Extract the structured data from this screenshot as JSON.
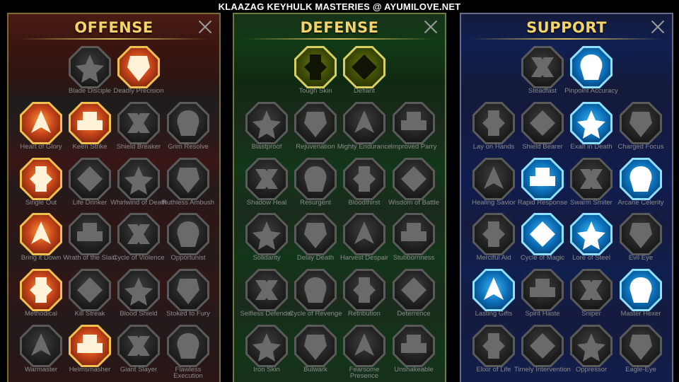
{
  "banner": "KLAAZAG KEYHULK MASTERIES @ AYUMILOVE.NET",
  "panels": [
    {
      "key": "offense",
      "title": "OFFENSE",
      "accent": "#f3d36a",
      "rows": [
        [
          {
            "name": "Blade Disciple",
            "icon": "crossed-swords-icon",
            "active": false
          },
          {
            "name": "Deadly Precision",
            "icon": "dagger-icon",
            "active": true
          }
        ],
        [
          {
            "name": "Heart of Glory",
            "icon": "horned-figure-icon",
            "active": true
          },
          {
            "name": "Keen Strike",
            "icon": "slash-icon",
            "active": true
          },
          {
            "name": "Shield Breaker",
            "icon": "shield-break-icon",
            "active": false
          },
          {
            "name": "Grim Resolve",
            "icon": "grim-heart-icon",
            "active": false
          }
        ],
        [
          {
            "name": "Single Out",
            "icon": "target-arrows-icon",
            "active": true
          },
          {
            "name": "Life Drinker",
            "icon": "fangs-icon",
            "active": false
          },
          {
            "name": "Whirlwind of Death",
            "icon": "whirlwind-icon",
            "active": false
          },
          {
            "name": "Ruthless Ambush",
            "icon": "ambush-dagger-icon",
            "active": false
          }
        ],
        [
          {
            "name": "Bring it Down",
            "icon": "falling-sword-icon",
            "active": true
          },
          {
            "name": "Wrath of the Slain",
            "icon": "fist-hammer-icon",
            "active": false
          },
          {
            "name": "Cycle of Violence",
            "icon": "axe-cycle-icon",
            "active": false
          },
          {
            "name": "Opportunist",
            "icon": "chain-lightning-icon",
            "active": false
          }
        ],
        [
          {
            "name": "Methodical",
            "icon": "burst-icon",
            "active": true
          },
          {
            "name": "Kill Streak",
            "icon": "skull-icon",
            "active": false
          },
          {
            "name": "Blood Shield",
            "icon": "sword-shield-icon",
            "active": false
          },
          {
            "name": "Stoked to Fury",
            "icon": "fury-figure-icon",
            "active": false
          }
        ],
        [
          {
            "name": "Warmaster",
            "icon": "sword-stars-icon",
            "active": false
          },
          {
            "name": "Helmsmasher",
            "icon": "helmet-icon",
            "active": true
          },
          {
            "name": "Giant Slayer",
            "icon": "giant-icon",
            "active": false
          },
          {
            "name": "Flawless Execution",
            "icon": "skull-blade-icon",
            "active": false
          }
        ]
      ]
    },
    {
      "key": "defense",
      "title": "DEFENSE",
      "accent": "#f3d36a",
      "rows": [
        [
          {
            "name": "Tough Skin",
            "icon": "armor-plates-icon",
            "active": true
          },
          {
            "name": "Defiant",
            "icon": "raised-fist-icon",
            "active": true
          }
        ],
        [
          {
            "name": "Blastproof",
            "icon": "blast-shield-icon",
            "active": false
          },
          {
            "name": "Rejuvenation",
            "icon": "leaf-hand-icon",
            "active": false
          },
          {
            "name": "Mighty Endurance",
            "icon": "strongman-icon",
            "active": false
          },
          {
            "name": "Improved Parry",
            "icon": "parry-blades-icon",
            "active": false
          }
        ],
        [
          {
            "name": "Shadow Heal",
            "icon": "shadow-figure-icon",
            "active": false
          },
          {
            "name": "Resurgent",
            "icon": "knight-shield-icon",
            "active": false
          },
          {
            "name": "Bloodthirst",
            "icon": "heart-skull-icon",
            "active": false
          },
          {
            "name": "Wisdom of Battle",
            "icon": "spiral-icon",
            "active": false
          }
        ],
        [
          {
            "name": "Solidarity",
            "icon": "group-fist-icon",
            "active": false
          },
          {
            "name": "Delay Death",
            "icon": "hourglass-icon",
            "active": false
          },
          {
            "name": "Harvest Despair",
            "icon": "open-hand-icon",
            "active": false
          },
          {
            "name": "Stubbornness",
            "icon": "bull-icon",
            "active": false
          }
        ],
        [
          {
            "name": "Selfless Defender",
            "icon": "runner-icon",
            "active": false
          },
          {
            "name": "Cycle of Revenge",
            "icon": "flames-icon",
            "active": false
          },
          {
            "name": "Retribution",
            "icon": "gear-skull-icon",
            "active": false
          },
          {
            "name": "Deterrence",
            "icon": "deflect-icon",
            "active": false
          }
        ],
        [
          {
            "name": "Iron Skin",
            "icon": "iron-figure-icon",
            "active": false
          },
          {
            "name": "Bulwark",
            "icon": "shield-icon",
            "active": false
          },
          {
            "name": "Fearsome Presence",
            "icon": "demon-face-icon",
            "active": false
          },
          {
            "name": "Unshakeable",
            "icon": "flex-figure-icon",
            "active": false
          }
        ]
      ]
    },
    {
      "key": "support",
      "title": "SUPPORT",
      "accent": "#f3d36a",
      "rows": [
        [
          {
            "name": "Steadfast",
            "icon": "sparkle-heart-icon",
            "active": false
          },
          {
            "name": "Pinpoint Accuracy",
            "icon": "bullseye-icon",
            "active": true
          }
        ],
        [
          {
            "name": "Lay on Hands",
            "icon": "praying-hands-icon",
            "active": false
          },
          {
            "name": "Shield Bearer",
            "icon": "arc-shield-icon",
            "active": false
          },
          {
            "name": "Exalt in Death",
            "icon": "blue-skull-icon",
            "active": true
          },
          {
            "name": "Charged Focus",
            "icon": "charged-arrow-icon",
            "active": false
          }
        ],
        [
          {
            "name": "Healing Savior",
            "icon": "healer-figure-icon",
            "active": false
          },
          {
            "name": "Rapid Response",
            "icon": "lightning-icon",
            "active": true
          },
          {
            "name": "Swarm Smiter",
            "icon": "swarm-icon",
            "active": false
          },
          {
            "name": "Arcane Celerity",
            "icon": "speed-figures-icon",
            "active": true
          }
        ],
        [
          {
            "name": "Merciful Aid",
            "icon": "chained-heart-icon",
            "active": false
          },
          {
            "name": "Cycle of Magic",
            "icon": "comet-icon",
            "active": true
          },
          {
            "name": "Lore of Steel",
            "icon": "open-book-icon",
            "active": true
          },
          {
            "name": "Evil Eye",
            "icon": "evil-eye-icon",
            "active": false
          }
        ],
        [
          {
            "name": "Lasting Gifts",
            "icon": "compass-star-icon",
            "active": true
          },
          {
            "name": "Spirit Haste",
            "icon": "haste-boot-icon",
            "active": false
          },
          {
            "name": "Sniper",
            "icon": "eye-icon",
            "active": false
          },
          {
            "name": "Master Hexer",
            "icon": "hex-figure-icon",
            "active": true
          }
        ],
        [
          {
            "name": "Elixir of Life",
            "icon": "potion-icon",
            "active": false
          },
          {
            "name": "Timely Intervention",
            "icon": "timely-skull-icon",
            "active": false
          },
          {
            "name": "Oppressor",
            "icon": "crushing-fist-icon",
            "active": false
          },
          {
            "name": "Eagle-Eye",
            "icon": "eagle-icon",
            "active": false
          }
        ]
      ]
    }
  ]
}
